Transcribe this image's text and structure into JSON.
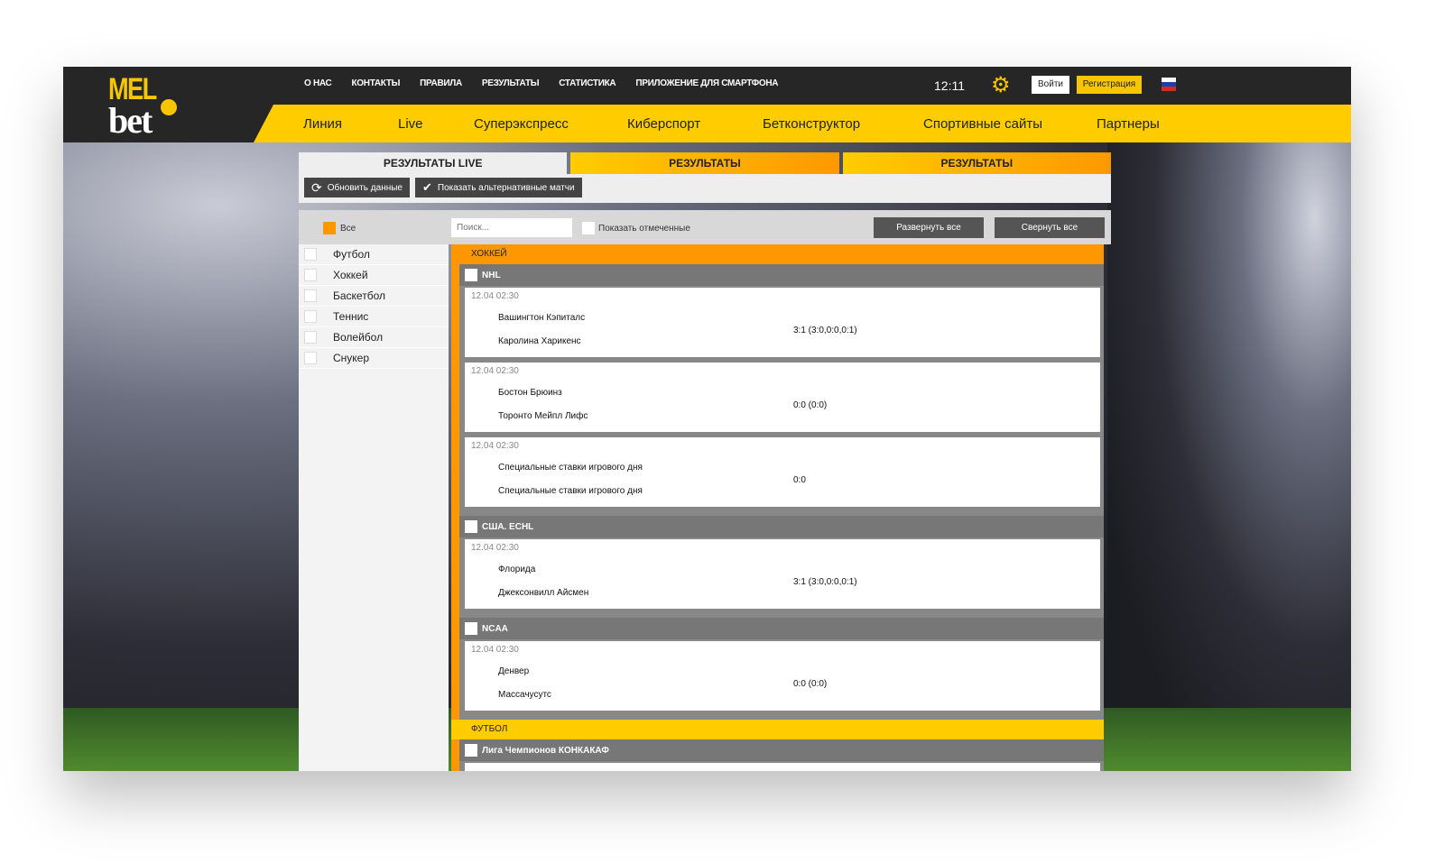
{
  "header": {
    "logo": "MELbet",
    "top_nav": [
      "О НАС",
      "КОНТАКТЫ",
      "ПРАВИЛА",
      "РЕЗУЛЬТАТЫ",
      "СТАТИСТИКА",
      "ПРИЛОЖЕНИЕ ДЛЯ СМАРТФОНА"
    ],
    "time": "12:11",
    "login": "Войти",
    "register": "Регистрация",
    "main_nav": [
      "Линия",
      "Live",
      "Суперэкспресс",
      "Киберспорт",
      "Бетконструктор",
      "Спортивные сайты",
      "Партнеры"
    ]
  },
  "tabs": [
    "РЕЗУЛЬТАТЫ LIVE",
    "РЕЗУЛЬТАТЫ",
    "РЕЗУЛЬТАТЫ"
  ],
  "toolbar": {
    "refresh": "Обновить данные",
    "alt": "Показать альтернативные матчи"
  },
  "filters": {
    "all": "Все",
    "search_placeholder": "Поиск...",
    "show_marked": "Показать отмеченные",
    "expand": "Развернуть все",
    "collapse": "Свернуть все"
  },
  "sidebar": [
    "Футбол",
    "Хоккей",
    "Баскетбол",
    "Теннис",
    "Волейбол",
    "Снукер"
  ],
  "sports": [
    {
      "name": "ХОККЕЙ",
      "leagues": [
        {
          "name": "NHL",
          "matches": [
            {
              "date": "12.04  02:30",
              "team1": "Вашингтон Кэпиталс",
              "team2": "Каролина Харикенс",
              "score": "3:1 (3:0,0:0,0:1)"
            },
            {
              "date": "12.04  02:30",
              "team1": "Бостон Брюинз",
              "team2": "Торонто Мейпл Лифс",
              "score": "0:0 (0:0)"
            },
            {
              "date": "12.04  02:30",
              "team1": "Специальные ставки игрового дня",
              "team2": "Специальные ставки игрового дня",
              "score": "0:0"
            }
          ]
        },
        {
          "name": "США. ECHL",
          "matches": [
            {
              "date": "12.04  02:30",
              "team1": "Флорида",
              "team2": "Джексонвилл Айсмен",
              "score": "3:1 (3:0,0:0,0:1)"
            }
          ]
        },
        {
          "name": "NCAA",
          "matches": [
            {
              "date": "12.04  02:30",
              "team1": "Денвер",
              "team2": "Массачусутс",
              "score": "0:0 (0:0)"
            }
          ]
        }
      ]
    },
    {
      "name": "ФУТБОЛ",
      "leagues": [
        {
          "name": "Лига Чемпионов КОНКАКАФ",
          "matches": [
            {
              "date": "",
              "team1": "",
              "team2": "",
              "score": ""
            }
          ]
        }
      ]
    }
  ]
}
